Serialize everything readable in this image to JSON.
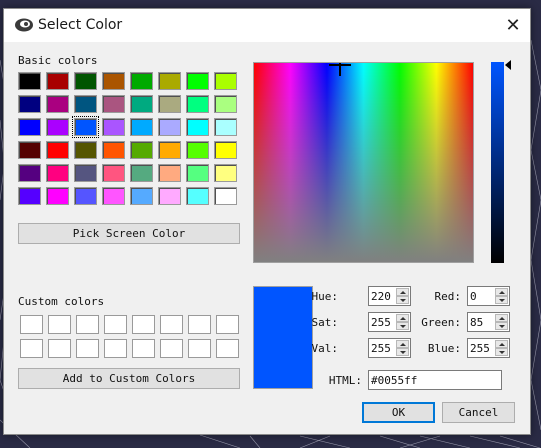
{
  "window": {
    "title": "Select Color",
    "close_glyph": "✕"
  },
  "basic_colors": {
    "label": "Basic colors",
    "swatches": [
      "#000000",
      "#a80000",
      "#005500",
      "#aa5500",
      "#00aa00",
      "#aaaa00",
      "#00ff00",
      "#aaff00",
      "#000080",
      "#aa0080",
      "#005580",
      "#aa5580",
      "#00aa80",
      "#aaaa80",
      "#00ff80",
      "#aaff80",
      "#0000ff",
      "#aa00ff",
      "#0055ff",
      "#aa55ff",
      "#00aaff",
      "#aaaaff",
      "#00ffff",
      "#aaffff",
      "#550000",
      "#ff0000",
      "#555500",
      "#ff5500",
      "#55aa00",
      "#ffaa00",
      "#55ff00",
      "#ffff00",
      "#550080",
      "#ff0080",
      "#555580",
      "#ff5580",
      "#55aa80",
      "#ffaa80",
      "#55ff80",
      "#ffff80",
      "#5500ff",
      "#ff00ff",
      "#5555ff",
      "#ff55ff",
      "#55aaff",
      "#ffaaff",
      "#55ffff",
      "#ffffff"
    ],
    "selected_index": 18
  },
  "pick_screen_button": "Pick Screen Color",
  "custom_colors": {
    "label": "Custom colors",
    "count": 16
  },
  "add_custom_button": "Add to Custom Colors",
  "current_color": "#0055ff",
  "fields": {
    "hue": {
      "label": "Hue:",
      "value": "220"
    },
    "sat": {
      "label": "Sat:",
      "value": "255"
    },
    "val": {
      "label": "Val:",
      "value": "255"
    },
    "red": {
      "label": "Red:",
      "value": "0"
    },
    "green": {
      "label": "Green:",
      "value": "85"
    },
    "blue": {
      "label": "Blue:",
      "value": "255"
    },
    "html": {
      "label": "HTML:",
      "value": "#0055ff"
    }
  },
  "ok_button": "OK",
  "cancel_button": "Cancel"
}
